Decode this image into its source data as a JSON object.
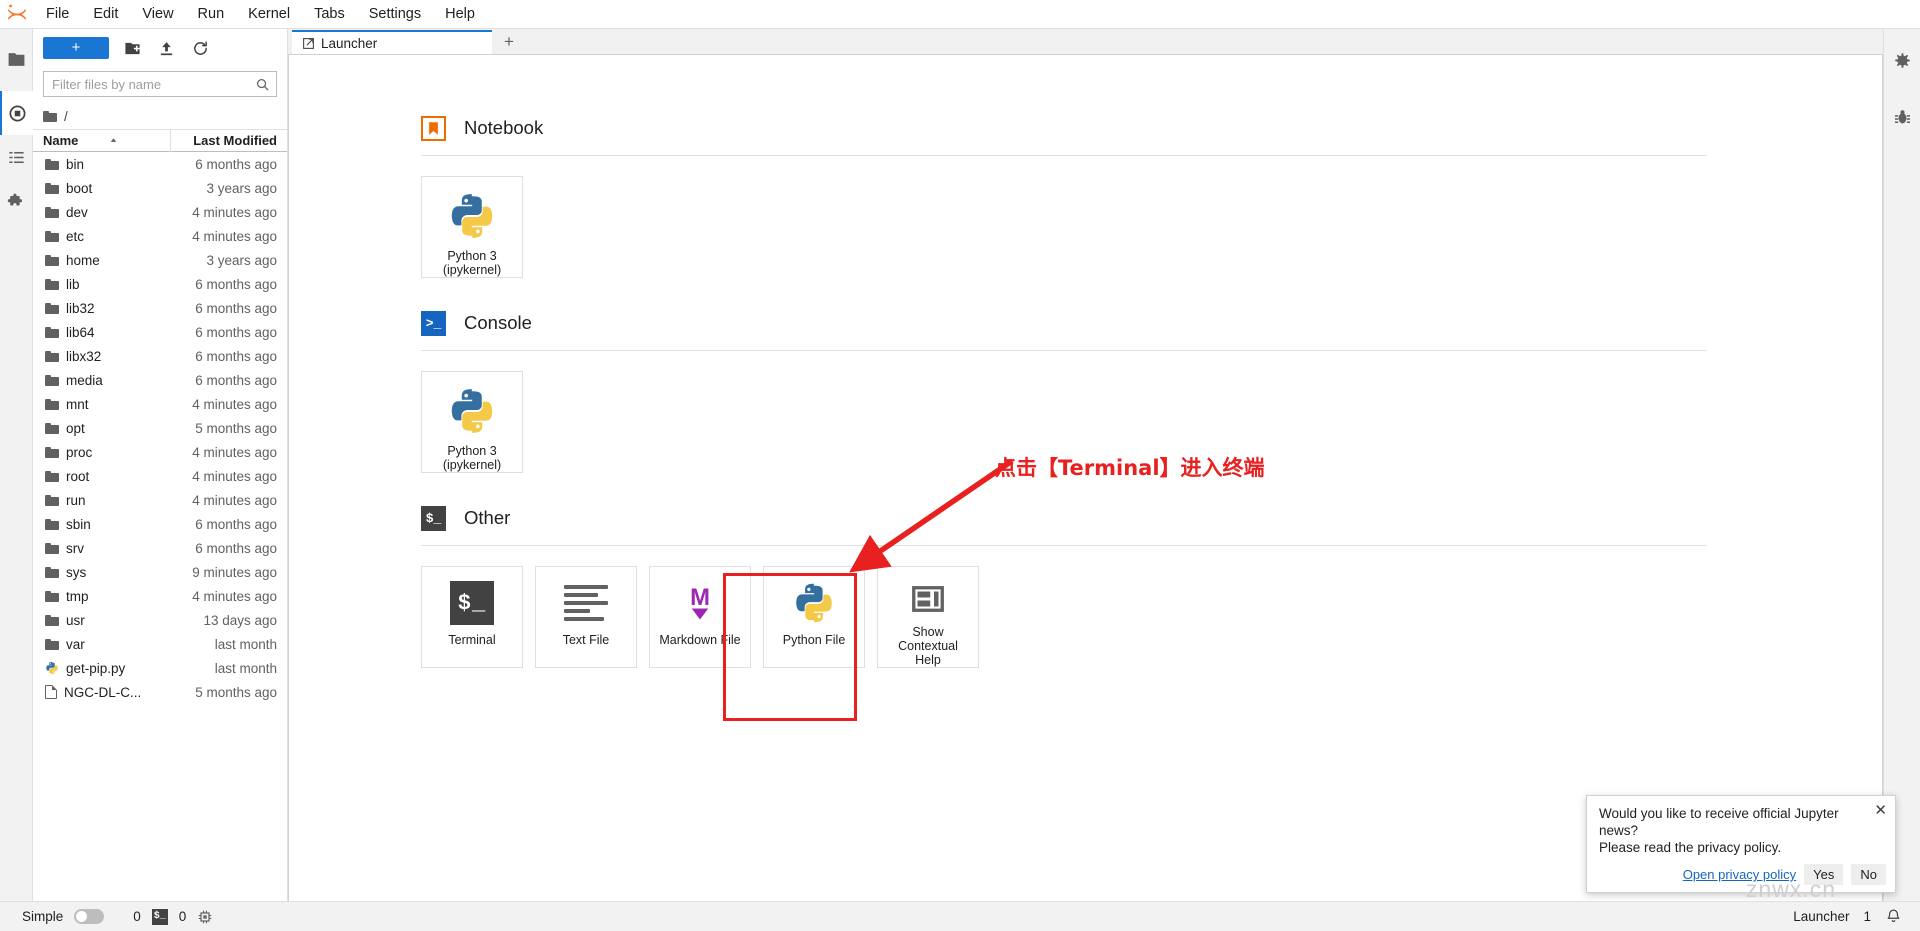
{
  "app": {
    "title": "JupyterLab",
    "logo_icon": "jupyter-logo-icon"
  },
  "menubar": {
    "items": [
      {
        "label": "File"
      },
      {
        "label": "Edit"
      },
      {
        "label": "View"
      },
      {
        "label": "Run"
      },
      {
        "label": "Kernel"
      },
      {
        "label": "Tabs"
      },
      {
        "label": "Settings"
      },
      {
        "label": "Help"
      }
    ]
  },
  "left_sidebar": {
    "items": [
      {
        "icon": "folder-icon",
        "name": "file-browser"
      },
      {
        "icon": "running-terminals-icon",
        "name": "running-sessions"
      },
      {
        "icon": "table-of-contents-icon",
        "name": "table-of-contents"
      },
      {
        "icon": "extension-manager-icon",
        "name": "extension-manager"
      }
    ]
  },
  "filebrowser": {
    "new_launcher_label": "+",
    "toolbar_icons": [
      "new-folder-icon",
      "upload-icon",
      "refresh-icon"
    ],
    "search": {
      "placeholder": "Filter files by name",
      "value": ""
    },
    "breadcrumb": {
      "root_icon": "folder-icon",
      "path": "/"
    },
    "columns": {
      "name": "Name",
      "last_modified": "Last Modified",
      "sort_icon": "sort-ascending-icon"
    },
    "rows": [
      {
        "type": "folder",
        "name": "bin",
        "modified": "6 months ago"
      },
      {
        "type": "folder",
        "name": "boot",
        "modified": "3 years ago"
      },
      {
        "type": "folder",
        "name": "dev",
        "modified": "4 minutes ago"
      },
      {
        "type": "folder",
        "name": "etc",
        "modified": "4 minutes ago"
      },
      {
        "type": "folder",
        "name": "home",
        "modified": "3 years ago"
      },
      {
        "type": "folder",
        "name": "lib",
        "modified": "6 months ago"
      },
      {
        "type": "folder",
        "name": "lib32",
        "modified": "6 months ago"
      },
      {
        "type": "folder",
        "name": "lib64",
        "modified": "6 months ago"
      },
      {
        "type": "folder",
        "name": "libx32",
        "modified": "6 months ago"
      },
      {
        "type": "folder",
        "name": "media",
        "modified": "6 months ago"
      },
      {
        "type": "folder",
        "name": "mnt",
        "modified": "4 minutes ago"
      },
      {
        "type": "folder",
        "name": "opt",
        "modified": "5 months ago"
      },
      {
        "type": "folder",
        "name": "proc",
        "modified": "4 minutes ago"
      },
      {
        "type": "folder",
        "name": "root",
        "modified": "4 minutes ago"
      },
      {
        "type": "folder",
        "name": "run",
        "modified": "4 minutes ago"
      },
      {
        "type": "folder",
        "name": "sbin",
        "modified": "6 months ago"
      },
      {
        "type": "folder",
        "name": "srv",
        "modified": "6 months ago"
      },
      {
        "type": "folder",
        "name": "sys",
        "modified": "9 minutes ago"
      },
      {
        "type": "folder",
        "name": "tmp",
        "modified": "4 minutes ago"
      },
      {
        "type": "folder",
        "name": "usr",
        "modified": "13 days ago"
      },
      {
        "type": "folder",
        "name": "var",
        "modified": "last month"
      },
      {
        "type": "python",
        "name": "get-pip.py",
        "modified": "last month"
      },
      {
        "type": "file",
        "name": "NGC-DL-C...",
        "modified": "5 months ago"
      }
    ]
  },
  "dock": {
    "tab": {
      "label": "Launcher",
      "icon": "launcher-icon"
    },
    "add_tab_label": "+"
  },
  "launcher": {
    "sections": [
      {
        "title": "Notebook",
        "badge": "notebook-badge-icon",
        "cards": [
          {
            "icon": "python-logo-icon",
            "label": "Python 3\n(ipykernel)"
          }
        ]
      },
      {
        "title": "Console",
        "badge": "console-badge-icon",
        "cards": [
          {
            "icon": "python-logo-icon",
            "label": "Python 3\n(ipykernel)"
          }
        ]
      },
      {
        "title": "Other",
        "badge": "terminal-badge-icon",
        "cards": [
          {
            "icon": "terminal-icon",
            "label": "Terminal"
          },
          {
            "icon": "text-file-icon",
            "label": "Text File"
          },
          {
            "icon": "markdown-icon",
            "label": "Markdown File"
          },
          {
            "icon": "python-logo-icon",
            "label": "Python File"
          },
          {
            "icon": "contextual-help-icon",
            "label": "Show\nContextual\nHelp"
          }
        ]
      }
    ]
  },
  "annotation": {
    "text": "点击【Terminal】进入终端",
    "color": "#e8201f"
  },
  "right_sidebar": {
    "items": [
      {
        "icon": "property-inspector-icon",
        "name": "property-inspector"
      },
      {
        "icon": "debugger-icon",
        "name": "debugger"
      }
    ]
  },
  "notification": {
    "line1": "Would you like to receive official Jupyter news?",
    "line2": "Please read the privacy policy.",
    "close_icon": "close-icon",
    "link_label": "Open privacy policy",
    "yes_label": "Yes",
    "no_label": "No"
  },
  "statusbar": {
    "mode_label": "Simple",
    "mode_enabled": false,
    "kernel_count": "0",
    "terminal_icon": "terminal-icon",
    "terminal_count": "0",
    "resource_icon": "cpu-icon",
    "active_tab": "Launcher",
    "notification_count": "1",
    "notification_icon": "bell-icon"
  },
  "watermark": {
    "text": "znwx.cn"
  },
  "colors": {
    "accent": "#1976d2",
    "annotation_red": "#e8201f",
    "notebook_orange": "#ef6c00",
    "console_blue": "#1565c0",
    "markdown_purple": "#9c27b0",
    "dark_gray": "#424242"
  }
}
